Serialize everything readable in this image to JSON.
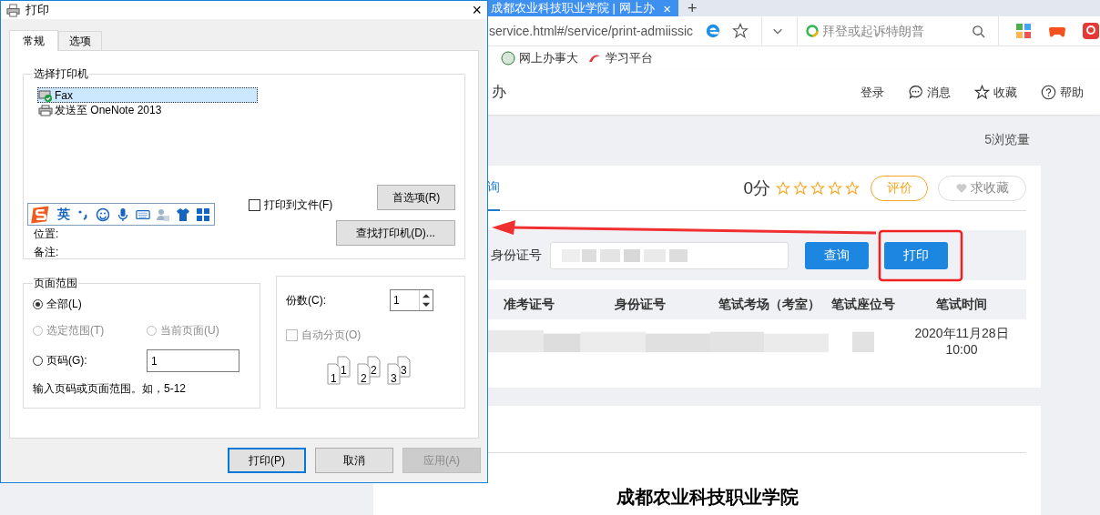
{
  "browser": {
    "tab": {
      "title": "成都农业科技职业学院 | 网上办",
      "close": "×"
    },
    "new_tab": "+",
    "address": "service.html#/service/print-admiissic",
    "search_placeholder": "拜登或起诉特朗普",
    "bookmarks": [
      "网上办事大",
      "学习平台"
    ]
  },
  "site": {
    "title_fragment": "办",
    "nav": [
      {
        "label": "登录",
        "kind": "text"
      },
      {
        "label": "消息",
        "kind": "chat"
      },
      {
        "label": "收藏",
        "kind": "star"
      },
      {
        "label": "帮助",
        "kind": "help"
      }
    ],
    "views": "5浏览量",
    "tabs": [
      {
        "label": "询",
        "selected": true
      }
    ],
    "score": "0分",
    "stars": 0,
    "rate_button": "评价",
    "favorite_button": "求收藏",
    "query": {
      "label": "身份证号",
      "search_button": "查询",
      "print_button": "打印"
    },
    "table": {
      "columns": [
        "准考证号",
        "身份证号",
        "笔试考场（考室）",
        "笔试座位号",
        "笔试时间"
      ],
      "rows": [
        {
          "exam_time": "2020年11月28日 10:00"
        }
      ]
    },
    "heading": "成都农业科技职业学院"
  },
  "dialog": {
    "title": "打印",
    "close": "×",
    "tabs": [
      {
        "label": "常规",
        "selected": true
      },
      {
        "label": "选项",
        "selected": false
      }
    ],
    "printer_group": {
      "title": "选择打印机",
      "printers": [
        {
          "name": "Fax",
          "selected": true,
          "kind": "fax"
        },
        {
          "name": "发送至 OneNote 2013",
          "selected": false,
          "kind": "printer"
        }
      ],
      "location_label": "位置:",
      "comment_label": "备注:",
      "print_to_file": {
        "label": "打印到文件(F)",
        "checked": false
      },
      "preferences_button": "首选项(R)",
      "find_button": "查找打印机(D)..."
    },
    "page_range": {
      "title": "页面范围",
      "options": [
        {
          "label": "全部(L)",
          "selected": true,
          "disabled": false
        },
        {
          "label": "选定范围(T)",
          "selected": false,
          "disabled": true
        },
        {
          "label": "当前页面(U)",
          "selected": false,
          "disabled": true
        },
        {
          "label": "页码(G):",
          "selected": false,
          "disabled": false
        }
      ],
      "pages_value": "1",
      "hint": "输入页码或页面范围。如，5-12"
    },
    "copies": {
      "label": "份数(C):",
      "value": "1",
      "collate": {
        "label": "自动分页(O)",
        "checked": false,
        "disabled": true
      },
      "collate_pages": [
        "1",
        "1",
        "2",
        "2",
        "3",
        "3"
      ]
    },
    "buttons": [
      {
        "label": "打印(P)",
        "kind": "default"
      },
      {
        "label": "取消",
        "kind": "normal"
      },
      {
        "label": "应用(A)",
        "kind": "disabled"
      }
    ]
  },
  "ime_toolbar": {
    "mode": "英"
  }
}
